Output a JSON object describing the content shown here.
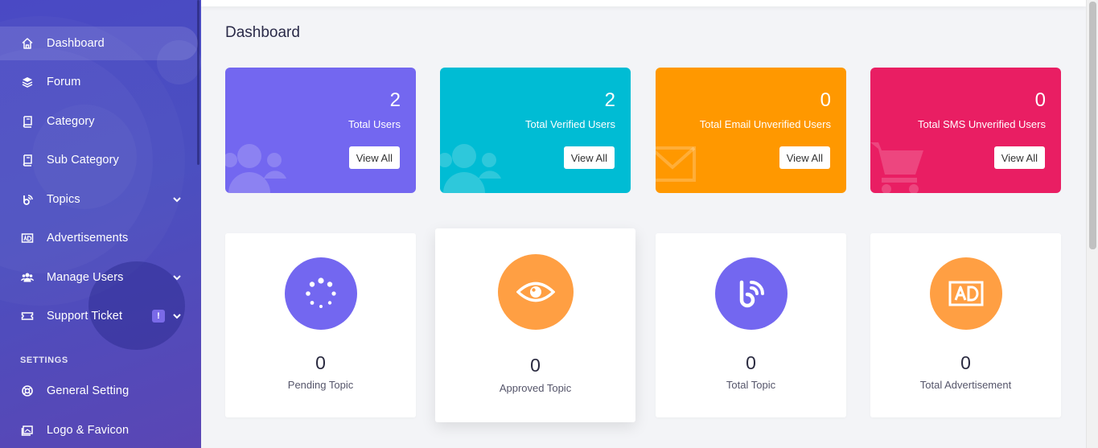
{
  "sidebar": {
    "items": [
      {
        "label": "Dashboard",
        "icon": "home-icon"
      },
      {
        "label": "Forum",
        "icon": "layers-icon"
      },
      {
        "label": "Category",
        "icon": "book-icon"
      },
      {
        "label": "Sub Category",
        "icon": "book-icon"
      },
      {
        "label": "Topics",
        "icon": "blogger-icon"
      },
      {
        "label": "Advertisements",
        "icon": "ad-icon"
      },
      {
        "label": "Manage Users",
        "icon": "users-icon"
      },
      {
        "label": "Support Ticket",
        "icon": "ticket-icon",
        "badge": "!"
      }
    ],
    "section_title": "SETTINGS",
    "settings_items": [
      {
        "label": "General Setting",
        "icon": "life-ring-icon"
      },
      {
        "label": "Logo & Favicon",
        "icon": "image-icon"
      }
    ],
    "colors": {
      "background": "#4a49c4",
      "badge": "#7a6ae8"
    }
  },
  "page": {
    "title": "Dashboard"
  },
  "stat_cards": [
    {
      "value": "2",
      "label": "Total Users",
      "button": "View All",
      "color": "#7367f0",
      "icon": "users-icon"
    },
    {
      "value": "2",
      "label": "Total Verified Users",
      "button": "View All",
      "color": "#00bcd4",
      "icon": "users-icon"
    },
    {
      "value": "0",
      "label": "Total Email Unverified Users",
      "button": "View All",
      "color": "#ff9800",
      "icon": "envelope-icon"
    },
    {
      "value": "0",
      "label": "Total SMS Unverified Users",
      "button": "View All",
      "color": "#e91e63",
      "icon": "cart-icon"
    }
  ],
  "info_cards": [
    {
      "value": "0",
      "label": "Pending Topic",
      "color": "#7367f0",
      "icon": "spinner-icon"
    },
    {
      "value": "0",
      "label": "Approved Topic",
      "color": "#ff9f43",
      "icon": "eye-icon"
    },
    {
      "value": "0",
      "label": "Total Topic",
      "color": "#7367f0",
      "icon": "blogger-icon"
    },
    {
      "value": "0",
      "label": "Total Advertisement",
      "color": "#ff9f43",
      "icon": "ad-icon"
    }
  ]
}
